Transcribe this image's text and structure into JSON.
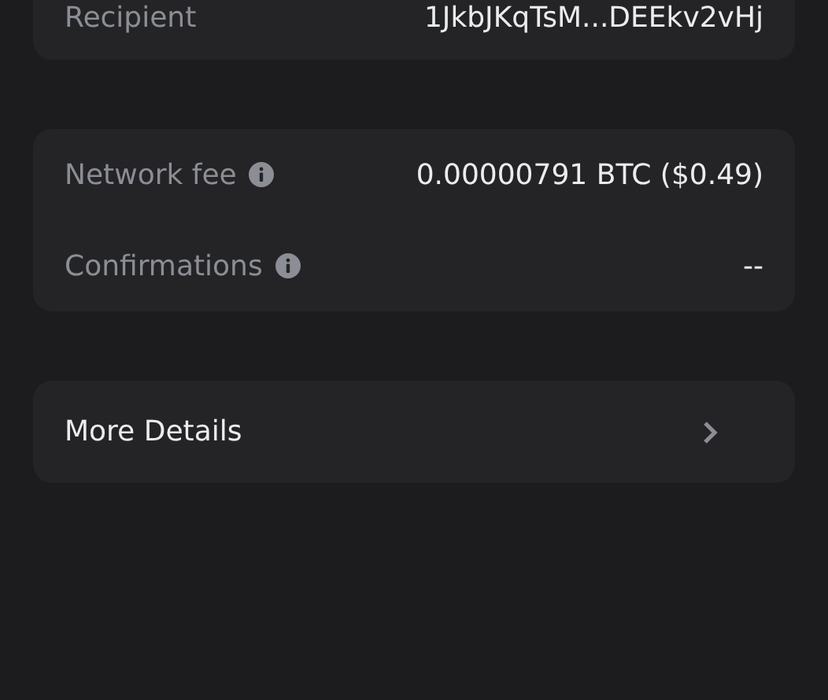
{
  "recipient_card": {
    "rows": [
      {
        "label": "Recipient",
        "value": "1JkbJKqTsM...DEEkv2vHj",
        "info": false
      }
    ]
  },
  "fee_card": {
    "rows": [
      {
        "label": "Network fee",
        "value": "0.00000791 BTC ($0.49)",
        "info": true
      },
      {
        "label": "Confirmations",
        "value": "--",
        "info": true
      }
    ]
  },
  "more_details": {
    "label": "More Details"
  }
}
